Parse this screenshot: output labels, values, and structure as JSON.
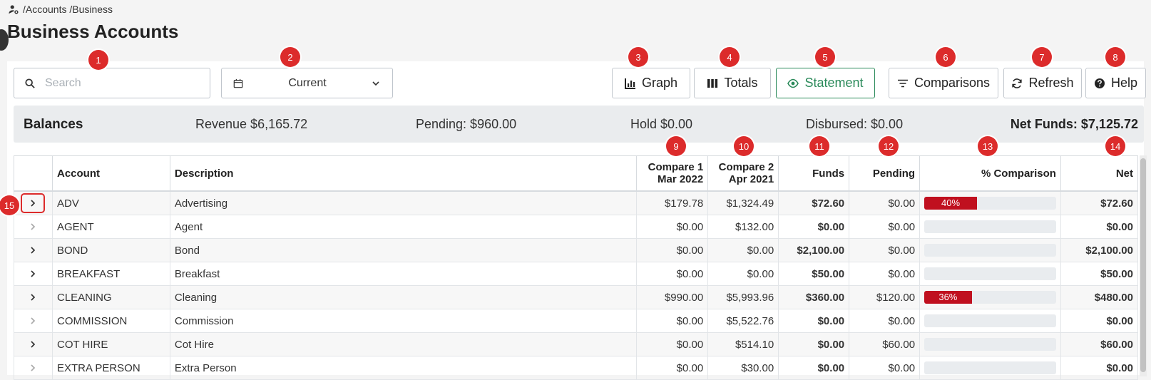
{
  "breadcrumb": "/Accounts /Business",
  "page_title": "Business Accounts",
  "search": {
    "placeholder": "Search",
    "value": ""
  },
  "period": {
    "value": "Current"
  },
  "toolbar": {
    "graph": "Graph",
    "totals": "Totals",
    "statement": "Statement",
    "comparisons": "Comparisons",
    "refresh": "Refresh",
    "help": "Help"
  },
  "badges": [
    "1",
    "2",
    "3",
    "4",
    "5",
    "6",
    "7",
    "8",
    "9",
    "10",
    "11",
    "12",
    "13",
    "14",
    "15"
  ],
  "balances": {
    "label": "Balances",
    "revenue": "Revenue $6,165.72",
    "pending": "Pending: $960.00",
    "hold": "Hold $0.00",
    "disbursed": "Disbursed: $0.00",
    "net_funds": "Net Funds: $7,125.72"
  },
  "table": {
    "headers": {
      "account": "Account",
      "description": "Description",
      "compare1_line1": "Compare 1",
      "compare1_line2": "Mar 2022",
      "compare2_line1": "Compare 2",
      "compare2_line2": "Apr 2021",
      "funds": "Funds",
      "pending": "Pending",
      "comparison": "% Comparison",
      "net": "Net"
    },
    "rows": [
      {
        "account": "ADV",
        "description": "Advertising",
        "c1": "$179.78",
        "c2": "$1,324.49",
        "funds": "$72.60",
        "pending": "$0.00",
        "pct": 0.4,
        "pct_label": "40%",
        "net": "$72.60"
      },
      {
        "account": "AGENT",
        "description": "Agent",
        "c1": "$0.00",
        "c2": "$132.00",
        "funds": "$0.00",
        "pending": "$0.00",
        "pct": 0,
        "pct_label": "",
        "net": "$0.00"
      },
      {
        "account": "BOND",
        "description": "Bond",
        "c1": "$0.00",
        "c2": "$0.00",
        "funds": "$2,100.00",
        "pending": "$0.00",
        "pct": 0,
        "pct_label": "",
        "net": "$2,100.00"
      },
      {
        "account": "BREAKFAST",
        "description": "Breakfast",
        "c1": "$0.00",
        "c2": "$0.00",
        "funds": "$50.00",
        "pending": "$0.00",
        "pct": 0,
        "pct_label": "",
        "net": "$50.00"
      },
      {
        "account": "CLEANING",
        "description": "Cleaning",
        "c1": "$990.00",
        "c2": "$5,993.96",
        "funds": "$360.00",
        "pending": "$120.00",
        "pct": 0.36,
        "pct_label": "36%",
        "net": "$480.00"
      },
      {
        "account": "COMMISSION",
        "description": "Commission",
        "c1": "$0.00",
        "c2": "$5,522.76",
        "funds": "$0.00",
        "pending": "$0.00",
        "pct": 0,
        "pct_label": "",
        "net": "$0.00"
      },
      {
        "account": "COT HIRE",
        "description": "Cot Hire",
        "c1": "$0.00",
        "c2": "$514.10",
        "funds": "$0.00",
        "pending": "$60.00",
        "pct": 0,
        "pct_label": "",
        "net": "$60.00"
      },
      {
        "account": "EXTRA PERSON",
        "description": "Extra Person",
        "c1": "$0.00",
        "c2": "$30.00",
        "funds": "$0.00",
        "pending": "$0.00",
        "pct": 0,
        "pct_label": "",
        "net": "$0.00"
      }
    ]
  }
}
